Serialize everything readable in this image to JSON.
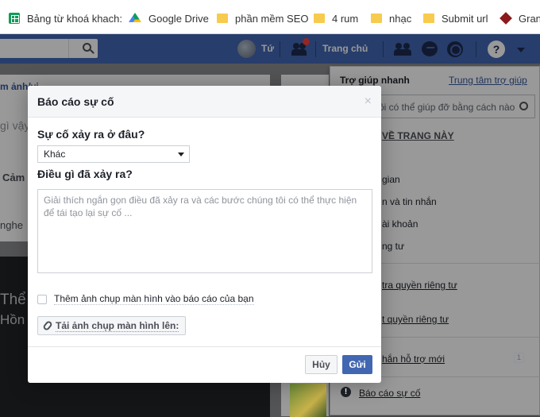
{
  "bookmarks": {
    "items": [
      {
        "label": "Bảng từ khoá khach:",
        "icon": "sheets-icon"
      },
      {
        "label": "Google Drive",
        "icon": "drive-icon"
      },
      {
        "label": "phần mềm SEO",
        "icon": "folder-icon"
      },
      {
        "label": "4 rum",
        "icon": "folder-icon"
      },
      {
        "label": "nhạc",
        "icon": "folder-icon"
      },
      {
        "label": "Submit url",
        "icon": "folder-icon"
      },
      {
        "label": "Gran",
        "icon": "diamond-icon"
      }
    ]
  },
  "fb_header": {
    "user_name": "Tứ",
    "home_label": "Trang chủ",
    "help_icon_glyph": "?",
    "brand_color": "#4267b2"
  },
  "background": {
    "card_label_1": "m ảnh/vi",
    "card_label_2": "gì vậy",
    "card_label_3": "Cảm s",
    "card_label_4": "nghe",
    "dark_text_1": "Thể C",
    "dark_text_2": "Hồn"
  },
  "help_panel": {
    "quick_help": "Trợ giúp nhanh",
    "help_center": "Trung tâm trợ giúp",
    "search_placeholder": "ôi có thể giúp đỡ bằng cách nào",
    "about_page": "VỀ TRANG NÀY",
    "items": [
      "gian",
      "n và tin nhắn",
      "ài khoản",
      "ng tư"
    ],
    "privacy_check": "tra quyền riêng tư",
    "privacy_settings": "t quyền riêng tư",
    "new_support": "hắn hỗ trợ mới",
    "new_support_count": "1",
    "report_problem": "Báo cáo sự cố"
  },
  "dialog": {
    "title": "Báo cáo sự cố",
    "close_glyph": "×",
    "where_question": "Sự cố xảy ra ở đâu?",
    "where_selected": "Khác",
    "what_question": "Điều gì đã xảy ra?",
    "what_placeholder": "Giải thích ngắn gọn điều đã xảy ra và các bước chúng tôi có thể thực hiện để tái tạo lại sự cố ...",
    "screenshot_checkbox": "Thêm ảnh chụp màn hình vào báo cáo của bạn",
    "upload_button": "Tải ảnh chụp màn hình lên:",
    "cancel_button": "Hủy",
    "send_button": "Gửi"
  }
}
